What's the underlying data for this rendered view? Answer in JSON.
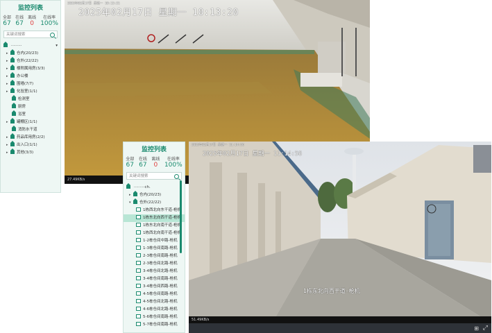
{
  "back_window": {
    "panel": {
      "title": "监控列表",
      "stats": [
        {
          "label": "全部",
          "value": "67"
        },
        {
          "label": "在线",
          "value": "67"
        },
        {
          "label": "离线",
          "value": "0"
        },
        {
          "label": "在线率",
          "value": "100%"
        }
      ],
      "search_placeholder": "关键词搜索",
      "root_label": "·········",
      "tree_items": [
        {
          "label": "仓内(20/23)",
          "type": "group"
        },
        {
          "label": "仓外(22/22)",
          "type": "group"
        },
        {
          "label": "楼附属用房(3/3)",
          "type": "group"
        },
        {
          "label": "办公楼",
          "type": "group"
        },
        {
          "label": "围墙(7/7)",
          "type": "group"
        },
        {
          "label": "化验室(1/1)",
          "type": "group"
        },
        {
          "label": "检测室",
          "type": "leaf"
        },
        {
          "label": "厨房",
          "type": "leaf"
        },
        {
          "label": "浴室",
          "type": "leaf"
        },
        {
          "label": "罐棚区(1/1)",
          "type": "group"
        },
        {
          "label": "消防水干道",
          "type": "leaf"
        },
        {
          "label": "药品库用房(2/2)",
          "type": "group"
        },
        {
          "label": "出入口(1/1)",
          "type": "group"
        },
        {
          "label": "其他(3/3)",
          "type": "group"
        }
      ]
    },
    "video": {
      "small_timestamp": "2025年02月17日 星期一 10:13:21",
      "osd": "2025年02月17日  星期一  10:13:20",
      "bitrate": "27.49KB/s"
    }
  },
  "front_window": {
    "panel": {
      "title": "监控列表",
      "stats": [
        {
          "label": "全部",
          "value": "67"
        },
        {
          "label": "在线",
          "value": "67"
        },
        {
          "label": "离线",
          "value": "0"
        },
        {
          "label": "在线率",
          "value": "100%"
        }
      ],
      "search_placeholder": "关键词搜索",
      "root_label": "·········ch.",
      "groups": [
        {
          "label": "仓内(20/23)",
          "expanded": false
        },
        {
          "label": "仓外(22/22)",
          "expanded": true
        }
      ],
      "cameras": [
        {
          "label": "1栋西北向东干道-枪机",
          "selected": false
        },
        {
          "label": "1栋东北向西干道-枪机",
          "selected": true
        },
        {
          "label": "1栋东北向南干道-枪机",
          "selected": false
        },
        {
          "label": "1栋西北向南干道-枪机",
          "selected": false
        },
        {
          "label": "1-2栋仓间中路-枪机",
          "selected": false
        },
        {
          "label": "1-3栋仓间南路-枪机",
          "selected": false
        },
        {
          "label": "2-3栋仓间南路-枪机",
          "selected": false
        },
        {
          "label": "2-3栋仓间北路-枪机",
          "selected": false
        },
        {
          "label": "3-4栋仓间北路-枪机",
          "selected": false
        },
        {
          "label": "3-4栋仓间南路-枪机",
          "selected": false
        },
        {
          "label": "3-4栋仓间西路-枪机",
          "selected": false
        },
        {
          "label": "4-5栋仓间南路-枪机",
          "selected": false
        },
        {
          "label": "4-5栋仓间北路-枪机",
          "selected": false
        },
        {
          "label": "4-6栋仓间北路-枪机",
          "selected": false
        },
        {
          "label": "5-6栋仓间南路-枪机",
          "selected": false
        },
        {
          "label": "5-7栋仓间南路-枪机",
          "selected": false
        }
      ]
    },
    "video": {
      "small_timestamp": "2025年02月17日 星期一 11:14:56",
      "osd": "2025年02月17日  星期一  11:14:56",
      "camera_label": "1栋东北向西干道-枪机",
      "bitrate": "51.49KB/s",
      "grid_icon": "grid-icon",
      "fullscreen_icon": "fullscreen-icon"
    }
  },
  "colors": {
    "accent": "#1a8a6e",
    "offline": "#e04040",
    "panel_bg": "#eef7f4"
  }
}
